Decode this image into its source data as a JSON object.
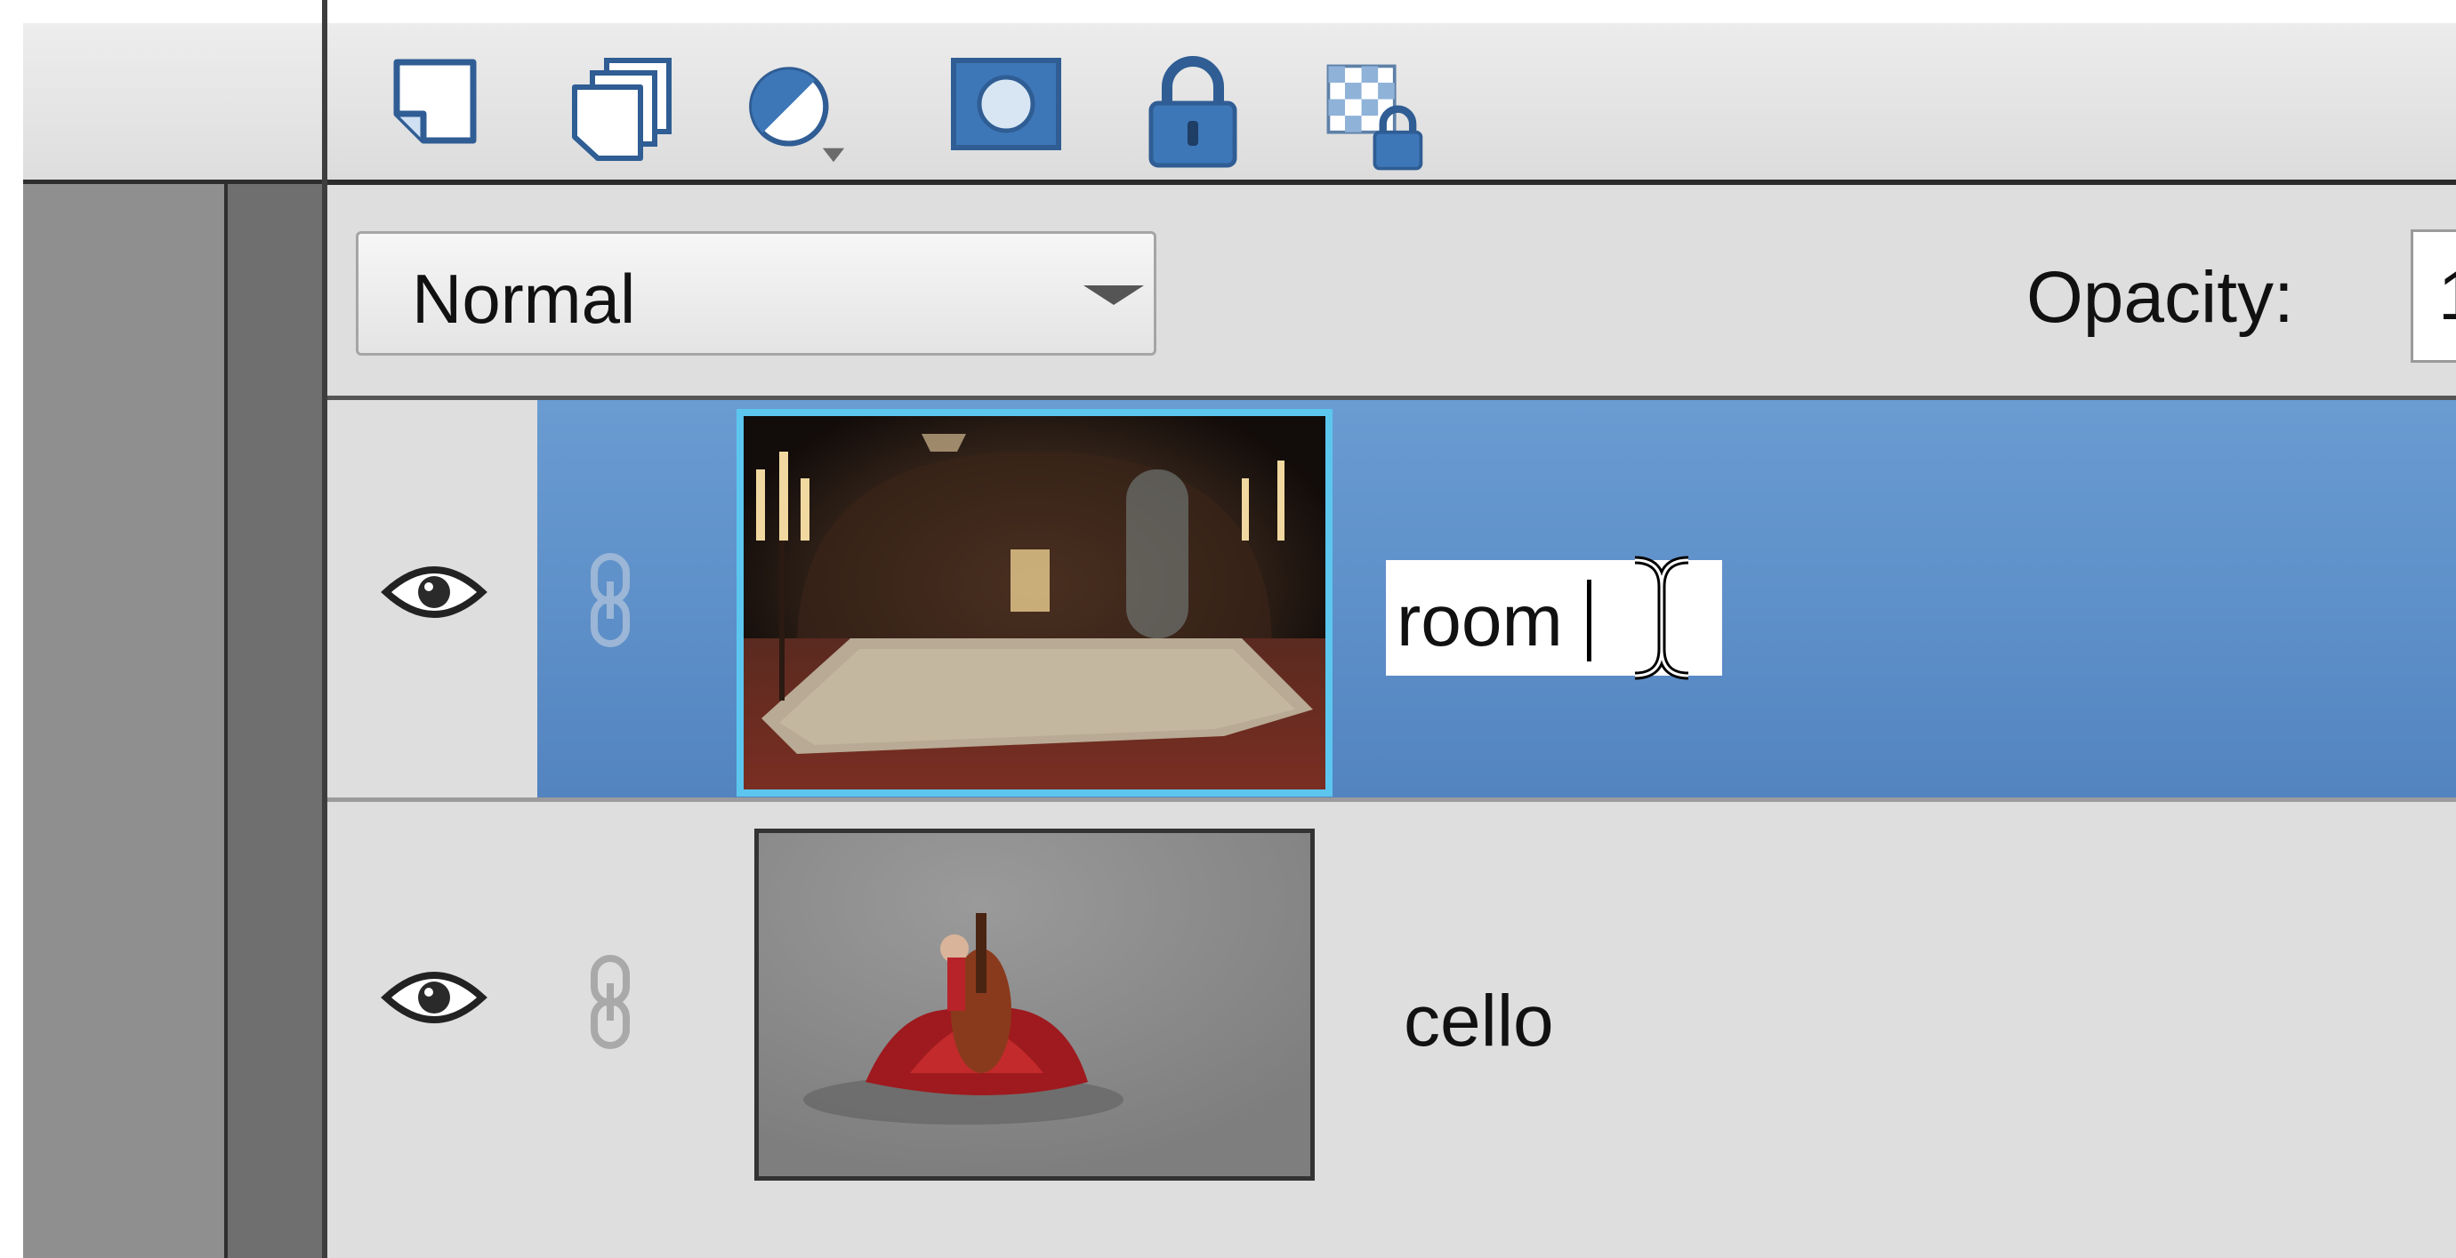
{
  "toolbar": {
    "icons": [
      "new-layer-icon",
      "new-group-icon",
      "adjustment-layer-icon",
      "layer-mask-icon",
      "lock-all-icon",
      "lock-transparency-icon"
    ]
  },
  "blend_mode": {
    "selected": "Normal"
  },
  "opacity": {
    "label": "Opacity:",
    "value": "1"
  },
  "layers": [
    {
      "name": "room",
      "selected": true,
      "editing": true,
      "visible": true,
      "thumbnail": "room-thumbnail"
    },
    {
      "name": "cello",
      "selected": false,
      "editing": false,
      "visible": true,
      "thumbnail": "cello-thumbnail"
    }
  ],
  "colors": {
    "selection": "#6494cc",
    "thumbnail_highlight": "#5cc6ef",
    "icon_blue": "#3d77b8"
  }
}
